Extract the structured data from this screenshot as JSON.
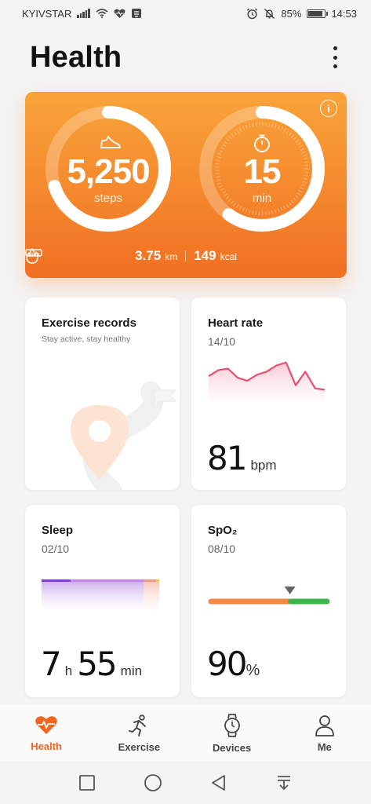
{
  "status_bar": {
    "carrier": "KYIVSTAR",
    "battery": "85%",
    "time": "14:53"
  },
  "header": {
    "title": "Health"
  },
  "activity": {
    "steps_value": "5,250",
    "steps_unit": "steps",
    "steps_progress": 0.7,
    "minutes_value": "15",
    "minutes_unit": "min",
    "minutes_progress": 0.6,
    "distance_value": "3.75",
    "distance_unit": "km",
    "calories_value": "149",
    "calories_unit": "kcal",
    "info_glyph": "i"
  },
  "exercise_card": {
    "title": "Exercise records",
    "subtitle": "Stay active, stay healthy"
  },
  "heart_card": {
    "title": "Heart rate",
    "date": "14/10",
    "value": "81",
    "unit": "bpm",
    "chart_data": {
      "type": "area",
      "values": [
        72,
        76,
        77,
        71,
        69,
        73,
        75,
        79,
        81,
        66,
        75,
        64,
        63
      ]
    }
  },
  "sleep_card": {
    "title": "Sleep",
    "date": "02/10",
    "hours_value": "7",
    "hours_unit": "h",
    "minutes_value": "55",
    "minutes_unit": "min"
  },
  "spo2_card": {
    "title": "SpO₂",
    "date": "08/10",
    "value": "90",
    "unit": "%",
    "level": 0.68
  },
  "bottom_nav": {
    "items": [
      {
        "label": "Health",
        "icon": "heart-icon"
      },
      {
        "label": "Exercise",
        "icon": "runner-icon"
      },
      {
        "label": "Devices",
        "icon": "watch-icon"
      },
      {
        "label": "Me",
        "icon": "person-icon"
      }
    ]
  },
  "colors": {
    "accent": "#f2641f",
    "heart_line": "#e8506e",
    "sleep_deep": "#7a3fc8",
    "sleep_light": "#c486e6",
    "spo2_low": "#f28a43",
    "spo2_normal": "#3cb44b"
  }
}
